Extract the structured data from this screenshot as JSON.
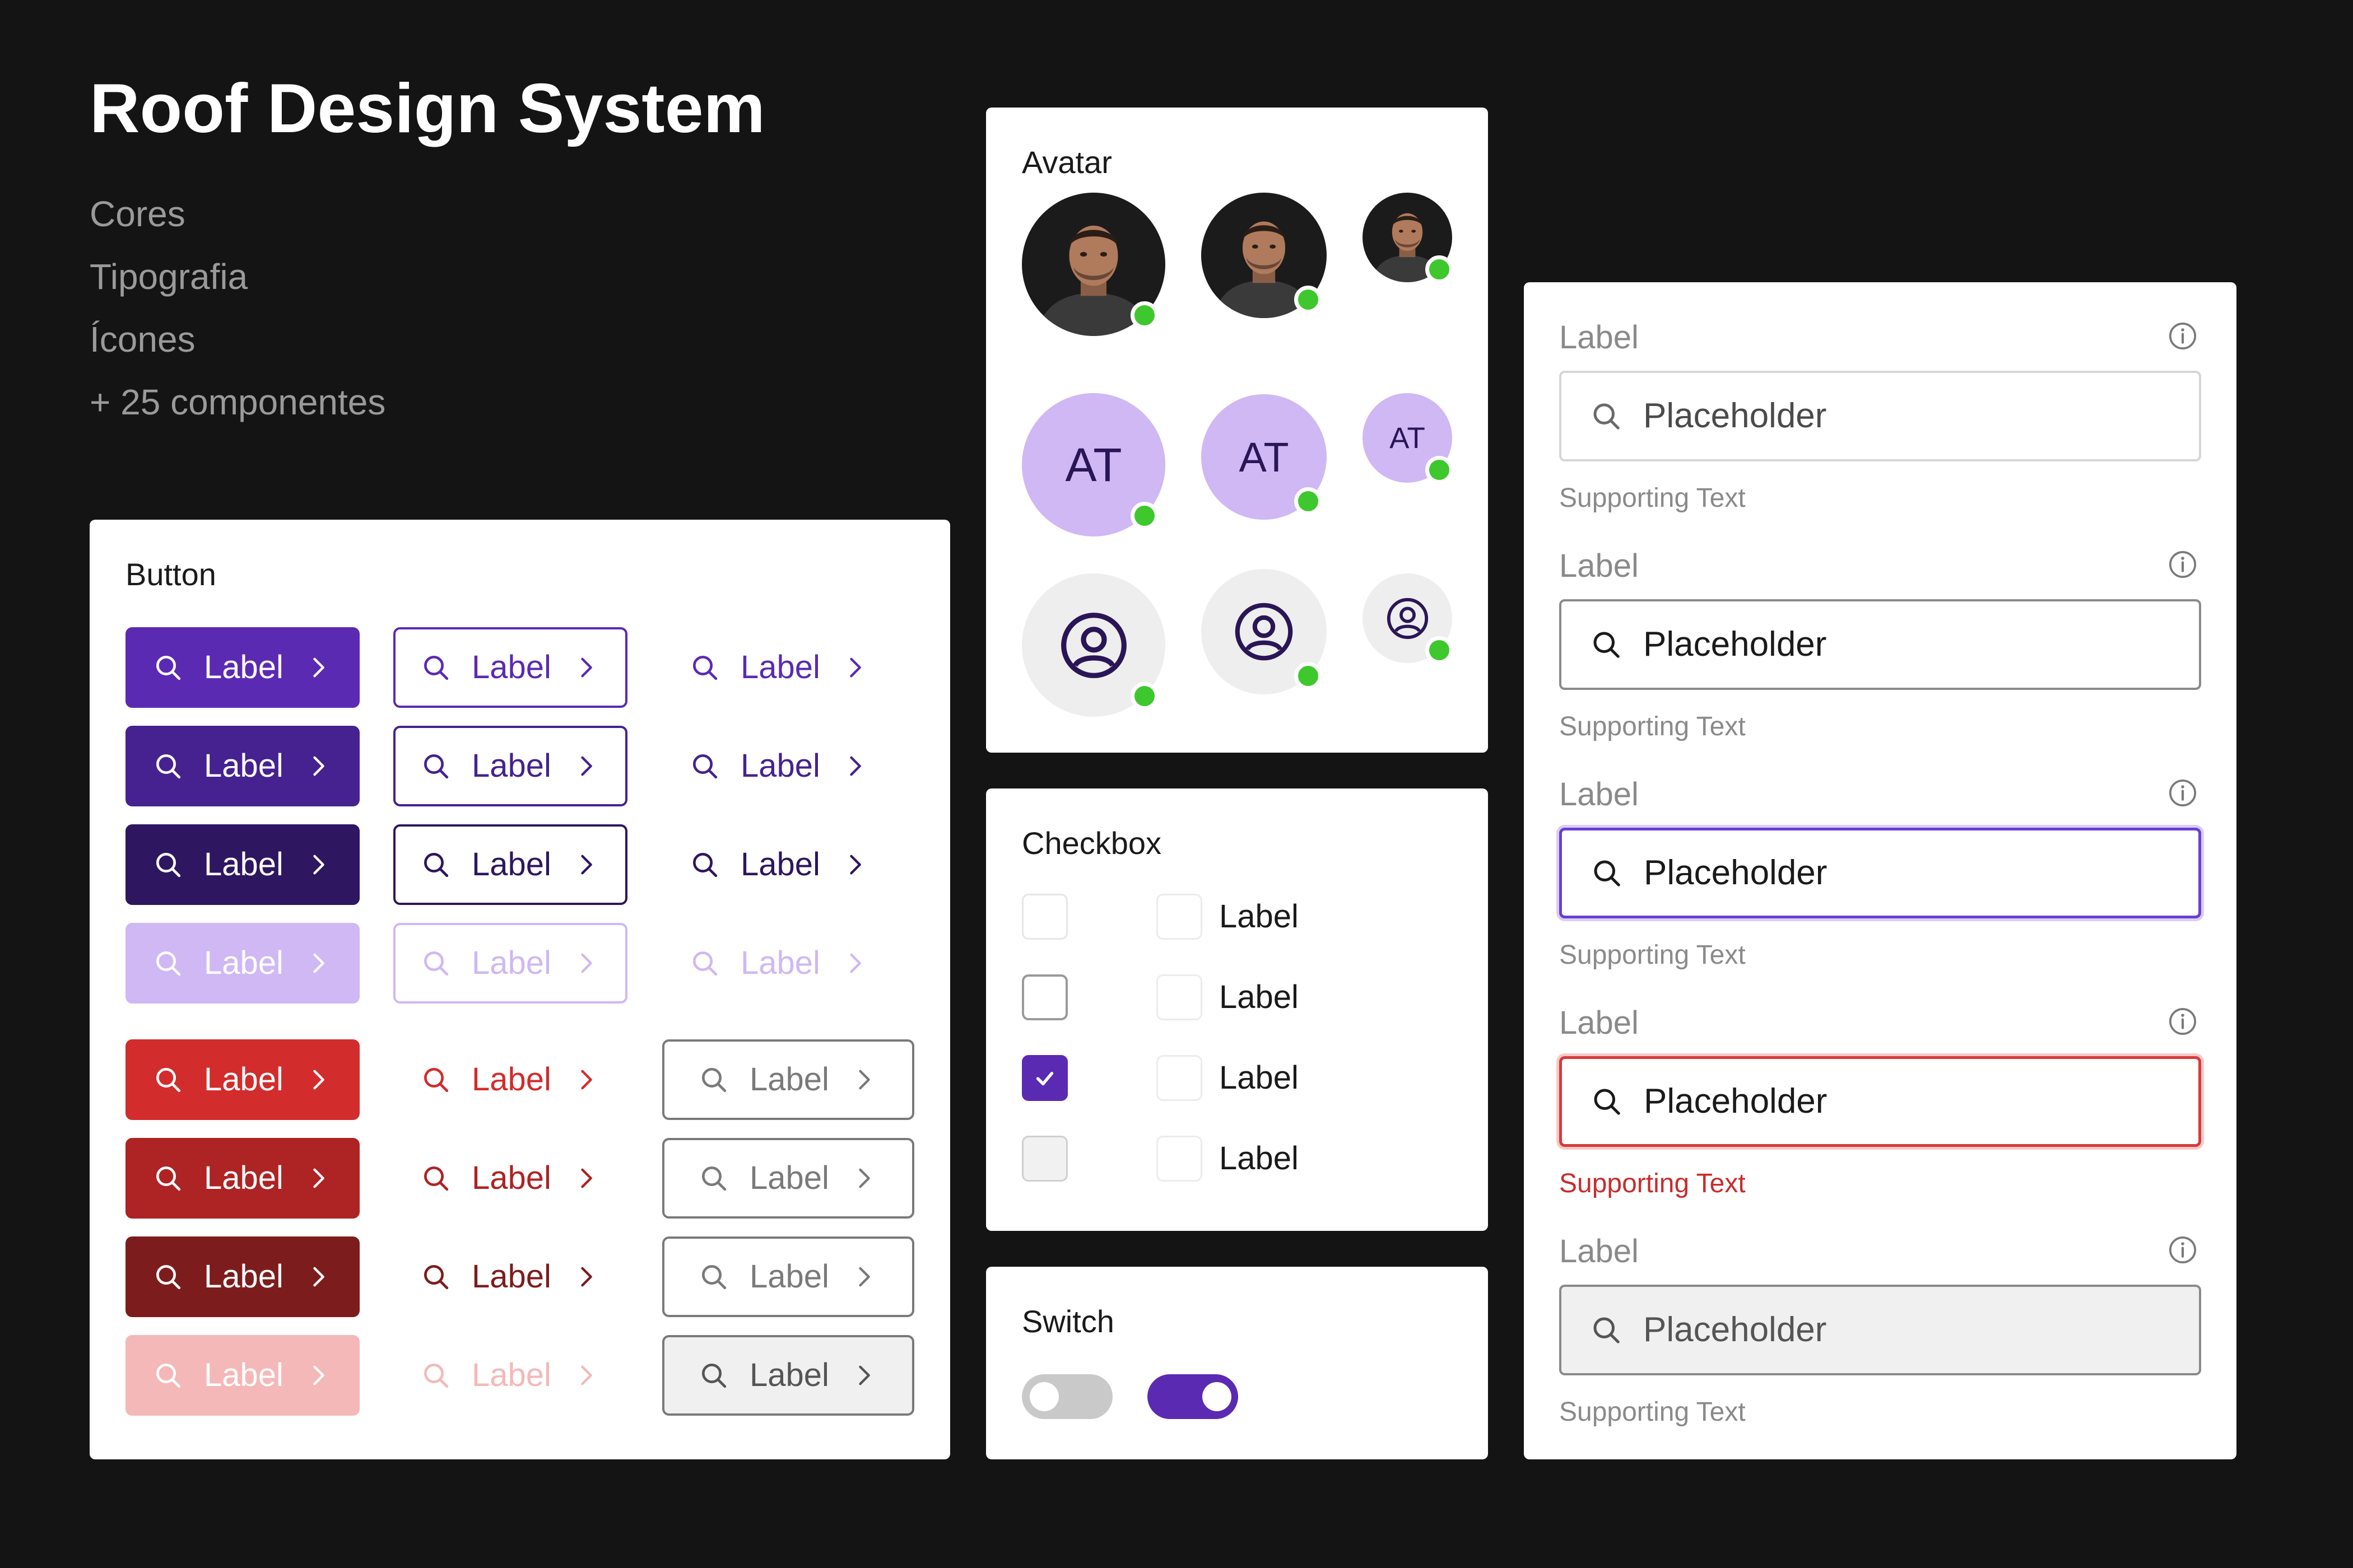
{
  "hero": {
    "title": "Roof Design System",
    "items": [
      "Cores",
      "Tipografia",
      "Ícones",
      "+ 25 componentes"
    ]
  },
  "button_card": {
    "title": "Button",
    "label": "Label",
    "colors": {
      "purple": "#5b2ab3",
      "purple_hover": "#45228f",
      "purple_pressed": "#2e1660",
      "purple_disabled": "#cfb8f4",
      "red": "#d22c2c",
      "red_hover": "#ae2323",
      "red_pressed": "#7d1c1c",
      "red_disabled": "#f4b8b8"
    }
  },
  "avatar_card": {
    "title": "Avatar",
    "initials": "AT",
    "status_color": "#3ec82d"
  },
  "checkbox_card": {
    "title": "Checkbox",
    "labels": [
      "Label",
      "Label",
      "Label",
      "Label"
    ]
  },
  "switch_card": {
    "title": "Switch",
    "switches": [
      {
        "on": false
      },
      {
        "on": true
      }
    ]
  },
  "fields": [
    {
      "label": "Label",
      "placeholder": "Placeholder",
      "supporting": "Supporting Text",
      "state": "default"
    },
    {
      "label": "Label",
      "placeholder": "Placeholder",
      "supporting": "Supporting Text",
      "state": "filled"
    },
    {
      "label": "Label",
      "placeholder": "Placeholder",
      "supporting": "Supporting Text",
      "state": "focus"
    },
    {
      "label": "Label",
      "placeholder": "Placeholder",
      "supporting": "Supporting Text",
      "state": "error"
    },
    {
      "label": "Label",
      "placeholder": "Placeholder",
      "supporting": "Supporting Text",
      "state": "disabled"
    }
  ]
}
